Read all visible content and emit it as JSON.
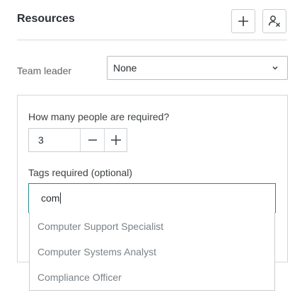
{
  "header": {
    "title": "Resources",
    "add_icon": "plus-icon",
    "remove_user_icon": "user-remove-icon"
  },
  "team_leader": {
    "label": "Team leader",
    "selected": "None"
  },
  "requirements": {
    "people_label": "How many people are required?",
    "people_count": "3",
    "tags_label": "Tags required (optional)",
    "tags_query": "com",
    "suggestions": [
      "Computer Support Specialist",
      "Computer Systems Analyst",
      "Compliance Officer"
    ]
  },
  "colors": {
    "accent": "#1f8a8f",
    "border": "#c9ced2",
    "muted_text": "#7c8287"
  }
}
